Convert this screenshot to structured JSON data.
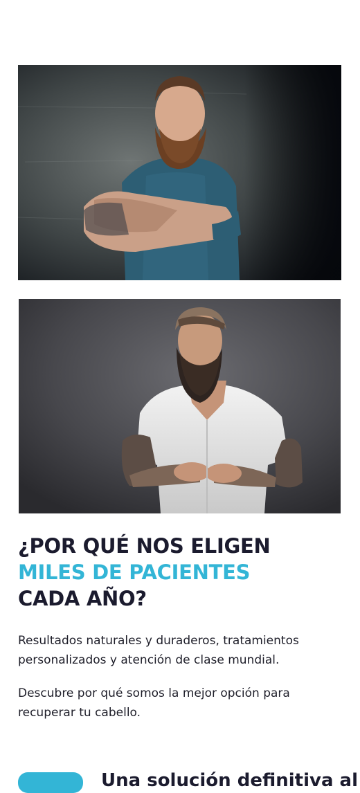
{
  "images": [
    {
      "name": "bearded-man-tattoo-arms-crossed-photo"
    },
    {
      "name": "bearded-man-white-shirt-photo"
    }
  ],
  "section": {
    "heading_line1": "¿POR QUÉ NOS ELIGEN",
    "heading_line2": "MILES DE PACIENTES",
    "heading_line3": "CADA AÑO?",
    "paragraph1": "Resultados naturales y duraderos, tratamientos personalizados y atención de clase mundial.",
    "paragraph2": "Descubre por qué somos la mejor opción para recuperar tu cabello.",
    "bottom_heading": "Una solución definitiva al"
  },
  "colors": {
    "accent": "#33b5d6",
    "dark_text": "#1b1b2e"
  }
}
